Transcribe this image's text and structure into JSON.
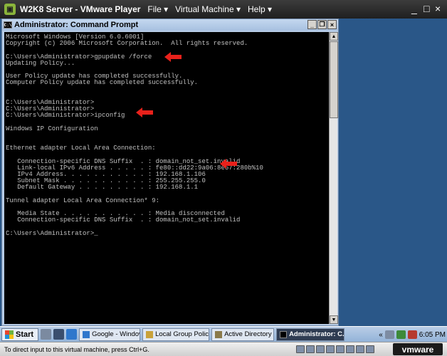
{
  "vmware": {
    "title": "W2K8 Server - VMware Player",
    "menus": [
      "File ▾",
      "Virtual Machine ▾",
      "Help ▾"
    ],
    "controls": {
      "minimize": "_",
      "maximize": "□",
      "close": "×"
    }
  },
  "cmd": {
    "title": "Administrator: Command Prompt",
    "icon_text": "C:\\",
    "buttons": {
      "minimize": "_",
      "restore": "❐",
      "close": "×"
    },
    "lines": [
      "Microsoft Windows [Version 6.0.6001]",
      "Copyright (c) 2006 Microsoft Corporation.  All rights reserved.",
      "",
      "C:\\Users\\Administrator>gpupdate /force",
      "Updating Policy...",
      "",
      "User Policy update has completed successfully.",
      "Computer Policy update has completed successfully.",
      "",
      "",
      "C:\\Users\\Administrator>",
      "C:\\Users\\Administrator>",
      "C:\\Users\\Administrator>ipconfig",
      "",
      "Windows IP Configuration",
      "",
      "",
      "Ethernet adapter Local Area Connection:",
      "",
      "   Connection-specific DNS Suffix  . : domain_not_set.invalid",
      "   Link-local IPv6 Address . . . . . : fe80::dd22:9a06:8e57:280b%10",
      "   IPv4 Address. . . . . . . . . . . : 192.168.1.106",
      "   Subnet Mask . . . . . . . . . . . : 255.255.255.0",
      "   Default Gateway . . . . . . . . . : 192.168.1.1",
      "",
      "Tunnel adapter Local Area Connection* 9:",
      "",
      "   Media State . . . . . . . . . . . : Media disconnected",
      "   Connection-specific DNS Suffix  . : domain_not_set.invalid",
      "",
      "C:\\Users\\Administrator>_"
    ]
  },
  "taskbar": {
    "start_label": "Start",
    "tasks": [
      {
        "label": "Google - Windows I...",
        "active": false
      },
      {
        "label": "Local Group Policy E...",
        "active": false
      },
      {
        "label": "Active Directory Us...",
        "active": false
      },
      {
        "label": "Administrator: C...",
        "active": true
      }
    ],
    "tray_chevron": "«",
    "clock": "6:05 PM"
  },
  "statusbar": {
    "hint": "To direct input to this virtual machine, press Ctrl+G.",
    "brand": "vmware"
  },
  "colors": {
    "annotation_arrow": "#e8211b",
    "console_text": "#c0c0c0",
    "desktop": "#2a5788"
  }
}
